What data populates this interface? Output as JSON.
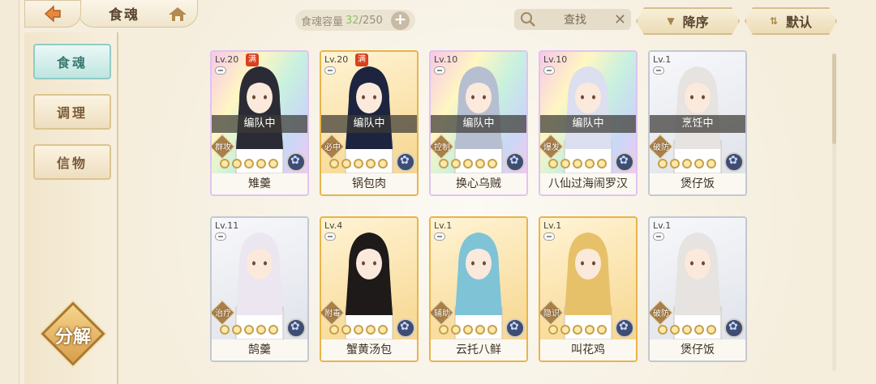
{
  "header": {
    "title": "食魂",
    "capacity_label": "食魂容量",
    "capacity_used": "32",
    "capacity_total": "/250",
    "add_label": "+",
    "search_label": "查找",
    "sort_label": "降序",
    "default_label": "默认"
  },
  "sidebar": {
    "items": [
      {
        "label": "食魂"
      },
      {
        "label": "调理"
      },
      {
        "label": "信物"
      }
    ],
    "decompose_label": "分解"
  },
  "cards": [
    {
      "level": "Lv.20",
      "name": "雉羹",
      "status": "编队中",
      "role": "群攻",
      "rarity": "rainbow",
      "max": "满",
      "hair": "#2b2b36",
      "stars": 0
    },
    {
      "level": "Lv.20",
      "name": "锅包肉",
      "status": "编队中",
      "role": "必中",
      "rarity": "gold",
      "max": "满",
      "hair": "#1d2440",
      "stars": 0
    },
    {
      "level": "Lv.10",
      "name": "换心乌贼",
      "status": "编队中",
      "role": "控制",
      "rarity": "rainbow",
      "max": "",
      "hair": "#b6bfd1",
      "stars": 0
    },
    {
      "level": "Lv.10",
      "name": "八仙过海闹罗汉",
      "status": "编队中",
      "role": "爆发",
      "rarity": "rainbow",
      "max": "",
      "hair": "#dcdff0",
      "stars": 0
    },
    {
      "level": "Lv.1",
      "name": "煲仔饭",
      "status": "烹饪中",
      "role": "破防",
      "rarity": "silver",
      "max": "",
      "hair": "#e6e3e0",
      "stars": 0
    },
    {
      "level": "Lv.11",
      "name": "鹄羹",
      "status": "",
      "role": "治疗",
      "rarity": "silver",
      "max": "",
      "hair": "#ebe6ef",
      "stars": 0
    },
    {
      "level": "Lv.4",
      "name": "蟹黄汤包",
      "status": "",
      "role": "附毒",
      "rarity": "gold",
      "max": "",
      "hair": "#1e1a1a",
      "stars": 0
    },
    {
      "level": "Lv.1",
      "name": "云托八鲜",
      "status": "",
      "role": "辅助",
      "rarity": "gold",
      "max": "",
      "hair": "#7fc3d6",
      "stars": 0
    },
    {
      "level": "Lv.1",
      "name": "叫花鸡",
      "status": "",
      "role": "隐识",
      "rarity": "gold",
      "max": "",
      "hair": "#e7c16a",
      "stars": 0
    },
    {
      "level": "Lv.1",
      "name": "煲仔饭",
      "status": "",
      "role": "破防",
      "rarity": "silver",
      "max": "",
      "hair": "#e6e3e0",
      "stars": 0
    }
  ]
}
